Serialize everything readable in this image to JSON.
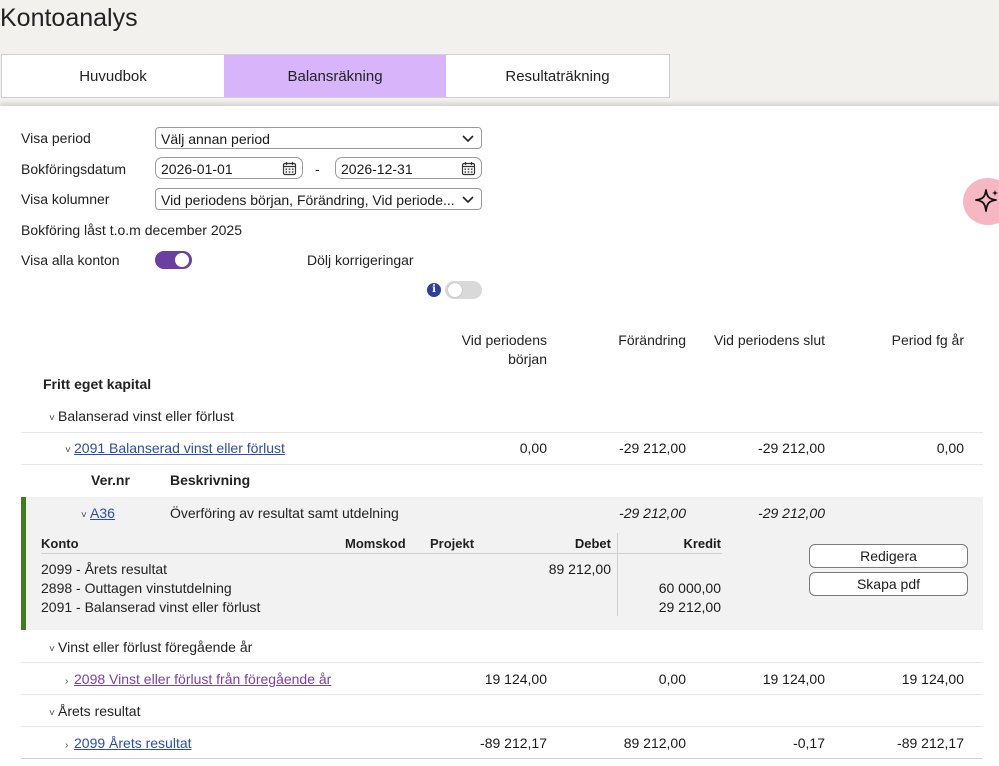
{
  "page": {
    "title": "Kontoanalys"
  },
  "tabs": [
    "Huvudbok",
    "Balansräkning",
    "Resultaträkning"
  ],
  "filters": {
    "period_label": "Visa period",
    "period_value": "Välj annan period",
    "date_label": "Bokföringsdatum",
    "date_from": "2026-01-01",
    "date_sep": "-",
    "date_to": "2026-12-31",
    "columns_label": "Visa kolumner",
    "columns_value": "Vid periodens början, Förändring, Vid periode...",
    "locked_text": "Bokföring låst t.o.m december 2025",
    "show_all_label": "Visa alla konton",
    "show_all_on": true,
    "hide_corr_label": "Dölj korrigeringar",
    "hide_corr_on": false,
    "info_glyph": "i"
  },
  "columns": {
    "start_line1": "Vid periodens",
    "start_line2": "början",
    "change": "Förändring",
    "end": "Vid periodens slut",
    "prev": "Period fg år"
  },
  "section_title": "Fritt eget kapital",
  "groups": {
    "g1": "Balanserad vinst eller förlust",
    "g2": "Vinst eller förlust föregående år",
    "g3": "Årets resultat"
  },
  "accounts": {
    "a2091": {
      "name": "2091 Balanserad vinst eller förlust",
      "start": "0,00",
      "change": "-29 212,00",
      "end": "-29 212,00",
      "prev": "0,00"
    },
    "a2098": {
      "name": "2098 Vinst eller förlust från föregående år",
      "start": "19 124,00",
      "change": "0,00",
      "end": "19 124,00",
      "prev": "19 124,00"
    },
    "a2099": {
      "name": "2099 Årets resultat",
      "start": "-89 212,17",
      "change": "89 212,00",
      "end": "-0,17",
      "prev": "-89 212,17"
    }
  },
  "voucher_headers": {
    "vernr": "Ver.nr",
    "desc": "Beskrivning"
  },
  "voucher": {
    "id": "A36",
    "desc": "Överföring av resultat samt utdelning",
    "change": "-29 212,00",
    "end": "-29 212,00"
  },
  "detail": {
    "headers": {
      "konto": "Konto",
      "momskod": "Momskod",
      "projekt": "Projekt",
      "debet": "Debet",
      "kredit": "Kredit"
    },
    "lines": [
      {
        "konto": "2099 - Årets resultat",
        "debet": "89 212,00",
        "kredit": ""
      },
      {
        "konto": "2898 - Outtagen vinstutdelning",
        "debet": "",
        "kredit": "60 000,00"
      },
      {
        "konto": "2091 - Balanserad vinst eller förlust",
        "debet": "",
        "kredit": "29 212,00"
      }
    ],
    "edit_label": "Redigera",
    "pdf_label": "Skapa pdf"
  },
  "icons": {
    "chevron_down": "chevron-down-icon",
    "chevron_right": "chevron-right-icon",
    "calendar": "calendar-icon",
    "sparkle": "sparkle-icon",
    "info": "info-icon"
  },
  "colors": {
    "accent": "#6b3fa0",
    "tab_active": "#d8b4fa",
    "link": "#2a4bb3",
    "link_visited": "#7a3fb0",
    "voucher_bar": "#3f7d1d"
  }
}
